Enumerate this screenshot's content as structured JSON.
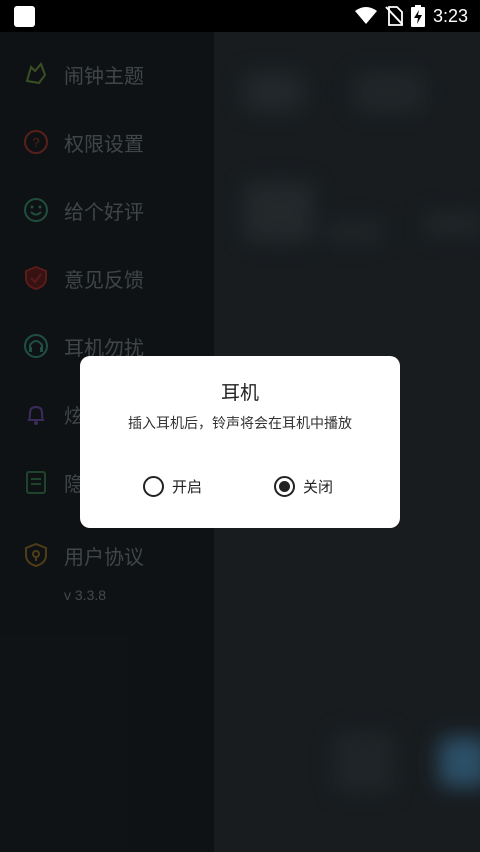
{
  "status_bar": {
    "time": "3:23",
    "icons": [
      "notification-icon",
      "wifi-icon",
      "no-sim-icon",
      "battery-charging-icon"
    ]
  },
  "drawer": {
    "items": [
      {
        "label": "闹钟主题",
        "icon": "theme-icon",
        "color": "#4e6a2f"
      },
      {
        "label": "权限设置",
        "icon": "question-icon",
        "color": "#7a2a24"
      },
      {
        "label": "给个好评",
        "icon": "smile-icon",
        "color": "#2a6a4e"
      },
      {
        "label": "意见反馈",
        "icon": "shield-check-icon",
        "color": "#7a2424"
      },
      {
        "label": "耳机勿扰",
        "icon": "headphones-icon",
        "color": "#2a6a5a"
      },
      {
        "label": "炫",
        "icon": "bell-icon",
        "color": "#4e3a7a"
      },
      {
        "label": "隐",
        "icon": "document-icon",
        "color": "#2a5a3a"
      },
      {
        "label": "用户协议",
        "icon": "lock-shield-icon",
        "color": "#6a5020"
      }
    ],
    "version": "v 3.3.8"
  },
  "dialog": {
    "title": "耳机",
    "message": "插入耳机后，铃声将会在耳机中播放",
    "options": [
      {
        "label": "开启",
        "checked": false
      },
      {
        "label": "关闭",
        "checked": true
      }
    ]
  }
}
